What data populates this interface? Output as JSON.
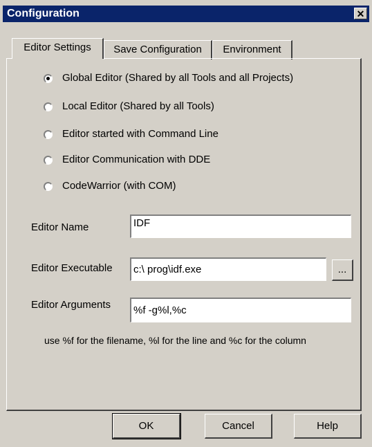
{
  "window": {
    "title": "Configuration",
    "close_symbol": "✕"
  },
  "tabs": [
    {
      "label": "Editor Settings"
    },
    {
      "label": "Save Configuration"
    },
    {
      "label": "Environment"
    }
  ],
  "editor_options": [
    {
      "label": "Global Editor (Shared by all Tools and all Projects)",
      "selected": true
    },
    {
      "label": "Local Editor (Shared by all Tools)",
      "selected": false
    },
    {
      "label": "Editor started with Command Line",
      "selected": false
    },
    {
      "label": "Editor Communication with DDE",
      "selected": false
    },
    {
      "label": "CodeWarrior (with COM)",
      "selected": false
    }
  ],
  "fields": {
    "editor_name": {
      "label": "Editor Name",
      "value": "IDF"
    },
    "editor_executable": {
      "label": "Editor Executable",
      "value": "c:\\ prog\\idf.exe",
      "browse_label": "..."
    },
    "editor_arguments": {
      "label": "Editor Arguments",
      "value": "%f -g%l,%c"
    }
  },
  "hint": "use %f for the filename, %l for the line and %c for the column",
  "buttons": {
    "ok": "OK",
    "cancel": "Cancel",
    "help": "Help"
  },
  "colors": {
    "title_bar": "#0a246a",
    "face": "#d4d0c8"
  }
}
